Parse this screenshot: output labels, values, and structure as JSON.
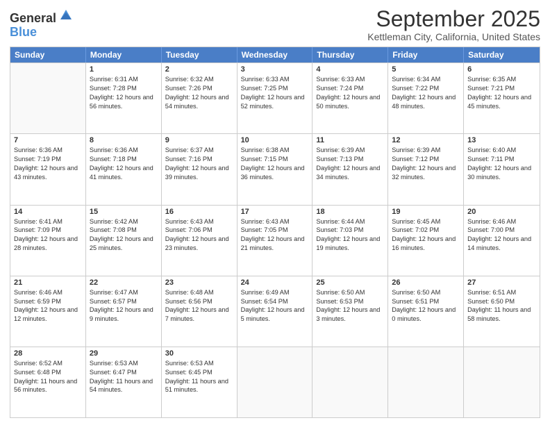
{
  "header": {
    "logo_line1": "General",
    "logo_line2": "Blue",
    "title": "September 2025",
    "subtitle": "Kettleman City, California, United States"
  },
  "days_of_week": [
    "Sunday",
    "Monday",
    "Tuesday",
    "Wednesday",
    "Thursday",
    "Friday",
    "Saturday"
  ],
  "weeks": [
    [
      {
        "day": "",
        "empty": true
      },
      {
        "day": "1",
        "sunrise": "Sunrise: 6:31 AM",
        "sunset": "Sunset: 7:28 PM",
        "daylight": "Daylight: 12 hours and 56 minutes."
      },
      {
        "day": "2",
        "sunrise": "Sunrise: 6:32 AM",
        "sunset": "Sunset: 7:26 PM",
        "daylight": "Daylight: 12 hours and 54 minutes."
      },
      {
        "day": "3",
        "sunrise": "Sunrise: 6:33 AM",
        "sunset": "Sunset: 7:25 PM",
        "daylight": "Daylight: 12 hours and 52 minutes."
      },
      {
        "day": "4",
        "sunrise": "Sunrise: 6:33 AM",
        "sunset": "Sunset: 7:24 PM",
        "daylight": "Daylight: 12 hours and 50 minutes."
      },
      {
        "day": "5",
        "sunrise": "Sunrise: 6:34 AM",
        "sunset": "Sunset: 7:22 PM",
        "daylight": "Daylight: 12 hours and 48 minutes."
      },
      {
        "day": "6",
        "sunrise": "Sunrise: 6:35 AM",
        "sunset": "Sunset: 7:21 PM",
        "daylight": "Daylight: 12 hours and 45 minutes."
      }
    ],
    [
      {
        "day": "7",
        "sunrise": "Sunrise: 6:36 AM",
        "sunset": "Sunset: 7:19 PM",
        "daylight": "Daylight: 12 hours and 43 minutes."
      },
      {
        "day": "8",
        "sunrise": "Sunrise: 6:36 AM",
        "sunset": "Sunset: 7:18 PM",
        "daylight": "Daylight: 12 hours and 41 minutes."
      },
      {
        "day": "9",
        "sunrise": "Sunrise: 6:37 AM",
        "sunset": "Sunset: 7:16 PM",
        "daylight": "Daylight: 12 hours and 39 minutes."
      },
      {
        "day": "10",
        "sunrise": "Sunrise: 6:38 AM",
        "sunset": "Sunset: 7:15 PM",
        "daylight": "Daylight: 12 hours and 36 minutes."
      },
      {
        "day": "11",
        "sunrise": "Sunrise: 6:39 AM",
        "sunset": "Sunset: 7:13 PM",
        "daylight": "Daylight: 12 hours and 34 minutes."
      },
      {
        "day": "12",
        "sunrise": "Sunrise: 6:39 AM",
        "sunset": "Sunset: 7:12 PM",
        "daylight": "Daylight: 12 hours and 32 minutes."
      },
      {
        "day": "13",
        "sunrise": "Sunrise: 6:40 AM",
        "sunset": "Sunset: 7:11 PM",
        "daylight": "Daylight: 12 hours and 30 minutes."
      }
    ],
    [
      {
        "day": "14",
        "sunrise": "Sunrise: 6:41 AM",
        "sunset": "Sunset: 7:09 PM",
        "daylight": "Daylight: 12 hours and 28 minutes."
      },
      {
        "day": "15",
        "sunrise": "Sunrise: 6:42 AM",
        "sunset": "Sunset: 7:08 PM",
        "daylight": "Daylight: 12 hours and 25 minutes."
      },
      {
        "day": "16",
        "sunrise": "Sunrise: 6:43 AM",
        "sunset": "Sunset: 7:06 PM",
        "daylight": "Daylight: 12 hours and 23 minutes."
      },
      {
        "day": "17",
        "sunrise": "Sunrise: 6:43 AM",
        "sunset": "Sunset: 7:05 PM",
        "daylight": "Daylight: 12 hours and 21 minutes."
      },
      {
        "day": "18",
        "sunrise": "Sunrise: 6:44 AM",
        "sunset": "Sunset: 7:03 PM",
        "daylight": "Daylight: 12 hours and 19 minutes."
      },
      {
        "day": "19",
        "sunrise": "Sunrise: 6:45 AM",
        "sunset": "Sunset: 7:02 PM",
        "daylight": "Daylight: 12 hours and 16 minutes."
      },
      {
        "day": "20",
        "sunrise": "Sunrise: 6:46 AM",
        "sunset": "Sunset: 7:00 PM",
        "daylight": "Daylight: 12 hours and 14 minutes."
      }
    ],
    [
      {
        "day": "21",
        "sunrise": "Sunrise: 6:46 AM",
        "sunset": "Sunset: 6:59 PM",
        "daylight": "Daylight: 12 hours and 12 minutes."
      },
      {
        "day": "22",
        "sunrise": "Sunrise: 6:47 AM",
        "sunset": "Sunset: 6:57 PM",
        "daylight": "Daylight: 12 hours and 9 minutes."
      },
      {
        "day": "23",
        "sunrise": "Sunrise: 6:48 AM",
        "sunset": "Sunset: 6:56 PM",
        "daylight": "Daylight: 12 hours and 7 minutes."
      },
      {
        "day": "24",
        "sunrise": "Sunrise: 6:49 AM",
        "sunset": "Sunset: 6:54 PM",
        "daylight": "Daylight: 12 hours and 5 minutes."
      },
      {
        "day": "25",
        "sunrise": "Sunrise: 6:50 AM",
        "sunset": "Sunset: 6:53 PM",
        "daylight": "Daylight: 12 hours and 3 minutes."
      },
      {
        "day": "26",
        "sunrise": "Sunrise: 6:50 AM",
        "sunset": "Sunset: 6:51 PM",
        "daylight": "Daylight: 12 hours and 0 minutes."
      },
      {
        "day": "27",
        "sunrise": "Sunrise: 6:51 AM",
        "sunset": "Sunset: 6:50 PM",
        "daylight": "Daylight: 11 hours and 58 minutes."
      }
    ],
    [
      {
        "day": "28",
        "sunrise": "Sunrise: 6:52 AM",
        "sunset": "Sunset: 6:48 PM",
        "daylight": "Daylight: 11 hours and 56 minutes."
      },
      {
        "day": "29",
        "sunrise": "Sunrise: 6:53 AM",
        "sunset": "Sunset: 6:47 PM",
        "daylight": "Daylight: 11 hours and 54 minutes."
      },
      {
        "day": "30",
        "sunrise": "Sunrise: 6:53 AM",
        "sunset": "Sunset: 6:45 PM",
        "daylight": "Daylight: 11 hours and 51 minutes."
      },
      {
        "day": "",
        "empty": true
      },
      {
        "day": "",
        "empty": true
      },
      {
        "day": "",
        "empty": true
      },
      {
        "day": "",
        "empty": true
      }
    ]
  ]
}
